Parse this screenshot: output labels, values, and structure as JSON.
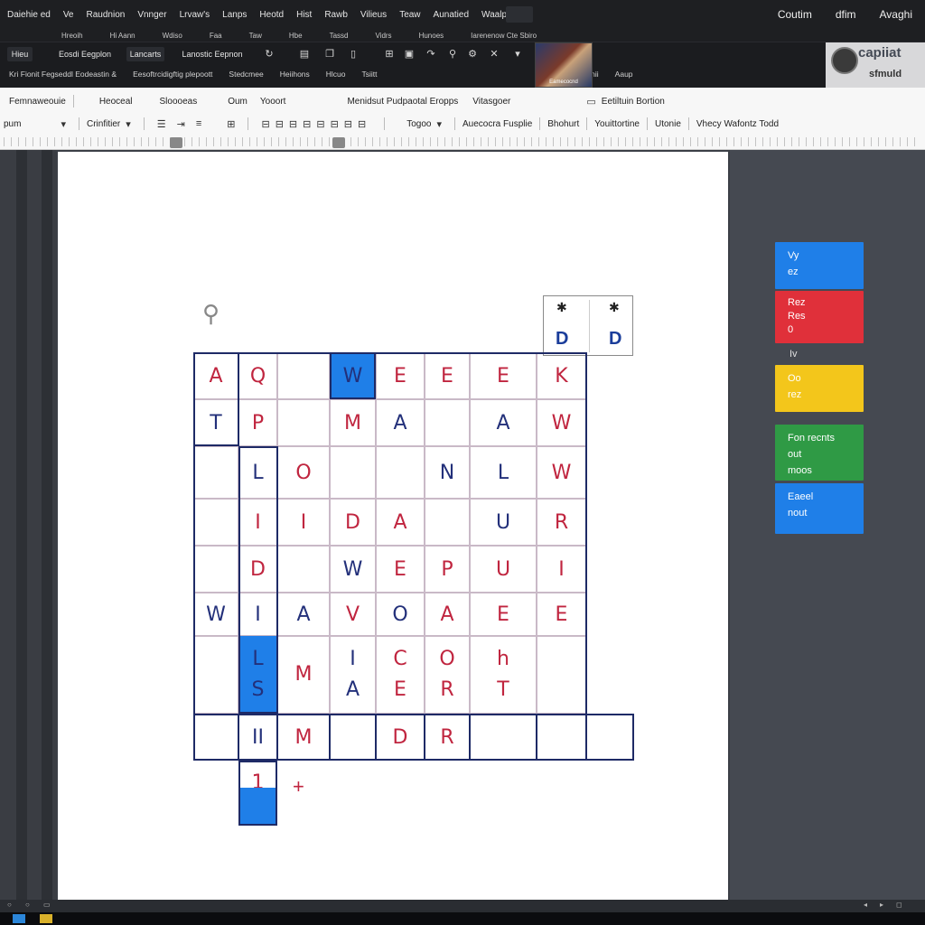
{
  "menu_bar": {
    "items": [
      "Daiehie ed",
      "Ve",
      "Raudnion",
      "Vnnger",
      "Lrvaw's",
      "Lanps",
      "Heotd",
      "Hist",
      "Rawb",
      "Vilieus",
      "Teaw",
      "Aunatied",
      "Waalp"
    ],
    "right": [
      "Coutim",
      "dfim",
      "Avaghi"
    ]
  },
  "sub_bar": {
    "items": [
      "Hreoih",
      "Hi Aann",
      "Wdiso",
      "Faa",
      "Taw",
      "Hbe",
      "Tassd",
      "Vidrs",
      "Hunoes",
      "Iarenenow Cte Sbiro"
    ]
  },
  "toolbar": {
    "chip1": "Hieu",
    "chip2": "Eosdi Eegplon",
    "chip3": "Lancarts",
    "chip4": "Lanostic Eepnon",
    "row_b": [
      "Kri Fionit Fegseddl Eodeastin &",
      "Eesoftrcidigftig plepoott",
      "Stedcmee",
      "Heiihons",
      "Hlcuo",
      "Tsiitt",
      "uatgis",
      "aactinii",
      "Aaup"
    ],
    "thumb_caption": "Eamecocnd",
    "logo_text": "capiiat",
    "logo_sub": "sfmuld"
  },
  "ribbon": {
    "row1": [
      "Femnaweouie",
      "Heoceal",
      "Sloooeas",
      "Oum",
      "Yooort",
      "Menidsut Pudpaotal Eropps",
      "Vitasgoer",
      "Eetiltuin Bortion"
    ],
    "row2_left": "pum",
    "row2_chars": "Crinfitier",
    "row2_mid": "Togoo",
    "row2_right": [
      "Auecocra Fusplie",
      "Bhohurt",
      "Youittortine",
      "Utonie",
      "Vhecy Wafontz Todd"
    ]
  },
  "grid": {
    "cells": [
      {
        "ch": "A",
        "c": "red"
      },
      {
        "ch": "Q",
        "c": "red"
      },
      {
        "ch": "W",
        "c": "blue"
      },
      {
        "ch": "E",
        "c": "red"
      },
      {
        "ch": "E",
        "c": "red"
      },
      {
        "ch": "E",
        "c": "red"
      },
      {
        "ch": "K",
        "c": "red"
      },
      {
        "ch": "T",
        "c": "blue"
      },
      {
        "ch": "P",
        "c": "red"
      },
      {
        "ch": "M",
        "c": "red"
      },
      {
        "ch": "A",
        "c": "blue"
      },
      {
        "ch": "A",
        "c": "blue"
      },
      {
        "ch": "W",
        "c": "red"
      },
      {
        "ch": "L",
        "c": "blue"
      },
      {
        "ch": "O",
        "c": "red"
      },
      {
        "ch": "N",
        "c": "blue"
      },
      {
        "ch": "L",
        "c": "blue"
      },
      {
        "ch": "W",
        "c": "red"
      },
      {
        "ch": "I",
        "c": "red"
      },
      {
        "ch": "I",
        "c": "red"
      },
      {
        "ch": "D",
        "c": "red"
      },
      {
        "ch": "A",
        "c": "red"
      },
      {
        "ch": "U",
        "c": "blue"
      },
      {
        "ch": "R",
        "c": "red"
      },
      {
        "ch": "D",
        "c": "red"
      },
      {
        "ch": "W",
        "c": "blue"
      },
      {
        "ch": "E",
        "c": "red"
      },
      {
        "ch": "P",
        "c": "red"
      },
      {
        "ch": "U",
        "c": "red"
      },
      {
        "ch": "I",
        "c": "red"
      },
      {
        "ch": "W",
        "c": "blue"
      },
      {
        "ch": "I",
        "c": "blue"
      },
      {
        "ch": "A",
        "c": "blue"
      },
      {
        "ch": "V",
        "c": "red"
      },
      {
        "ch": "O",
        "c": "blue"
      },
      {
        "ch": "A",
        "c": "red"
      },
      {
        "ch": "E",
        "c": "red"
      },
      {
        "ch": "E",
        "c": "red"
      },
      {
        "ch": "L",
        "c": "blue"
      },
      {
        "ch": "M",
        "c": "red"
      },
      {
        "ch": "I",
        "c": "blue"
      },
      {
        "ch": "C",
        "c": "red"
      },
      {
        "ch": "O",
        "c": "red"
      },
      {
        "ch": "h",
        "c": "red"
      },
      {
        "ch": "S",
        "c": "blue"
      },
      {
        "ch": "A",
        "c": "blue"
      },
      {
        "ch": "E",
        "c": "red"
      },
      {
        "ch": "R",
        "c": "red"
      },
      {
        "ch": "T",
        "c": "red"
      },
      {
        "ch": "II",
        "c": "blue"
      },
      {
        "ch": "M",
        "c": "red"
      },
      {
        "ch": "D",
        "c": "red"
      },
      {
        "ch": "R",
        "c": "red"
      },
      {
        "ch": "1",
        "c": "red"
      }
    ],
    "mini_letters": [
      "D",
      "D"
    ],
    "plus": "+"
  },
  "side_tiles": [
    {
      "lines": [
        "Vy",
        "ez"
      ],
      "color": "#1f7fe8"
    },
    {
      "lines": [
        "Rez",
        "Res",
        "0"
      ],
      "color": "#e0303a"
    },
    {
      "lines": [
        "Oo",
        "rez"
      ],
      "color": "#f3c61b"
    },
    {
      "lines": [
        "Fon recnts",
        "out",
        "moos"
      ],
      "color": "#2f9a45"
    },
    {
      "lines": [
        "Eaeel",
        "nout"
      ],
      "color": "#1f7fe8"
    }
  ],
  "side_caption": "Iv",
  "icons": [
    "pin-icon",
    "bug-icon",
    "gear-icon",
    "window-icon"
  ]
}
